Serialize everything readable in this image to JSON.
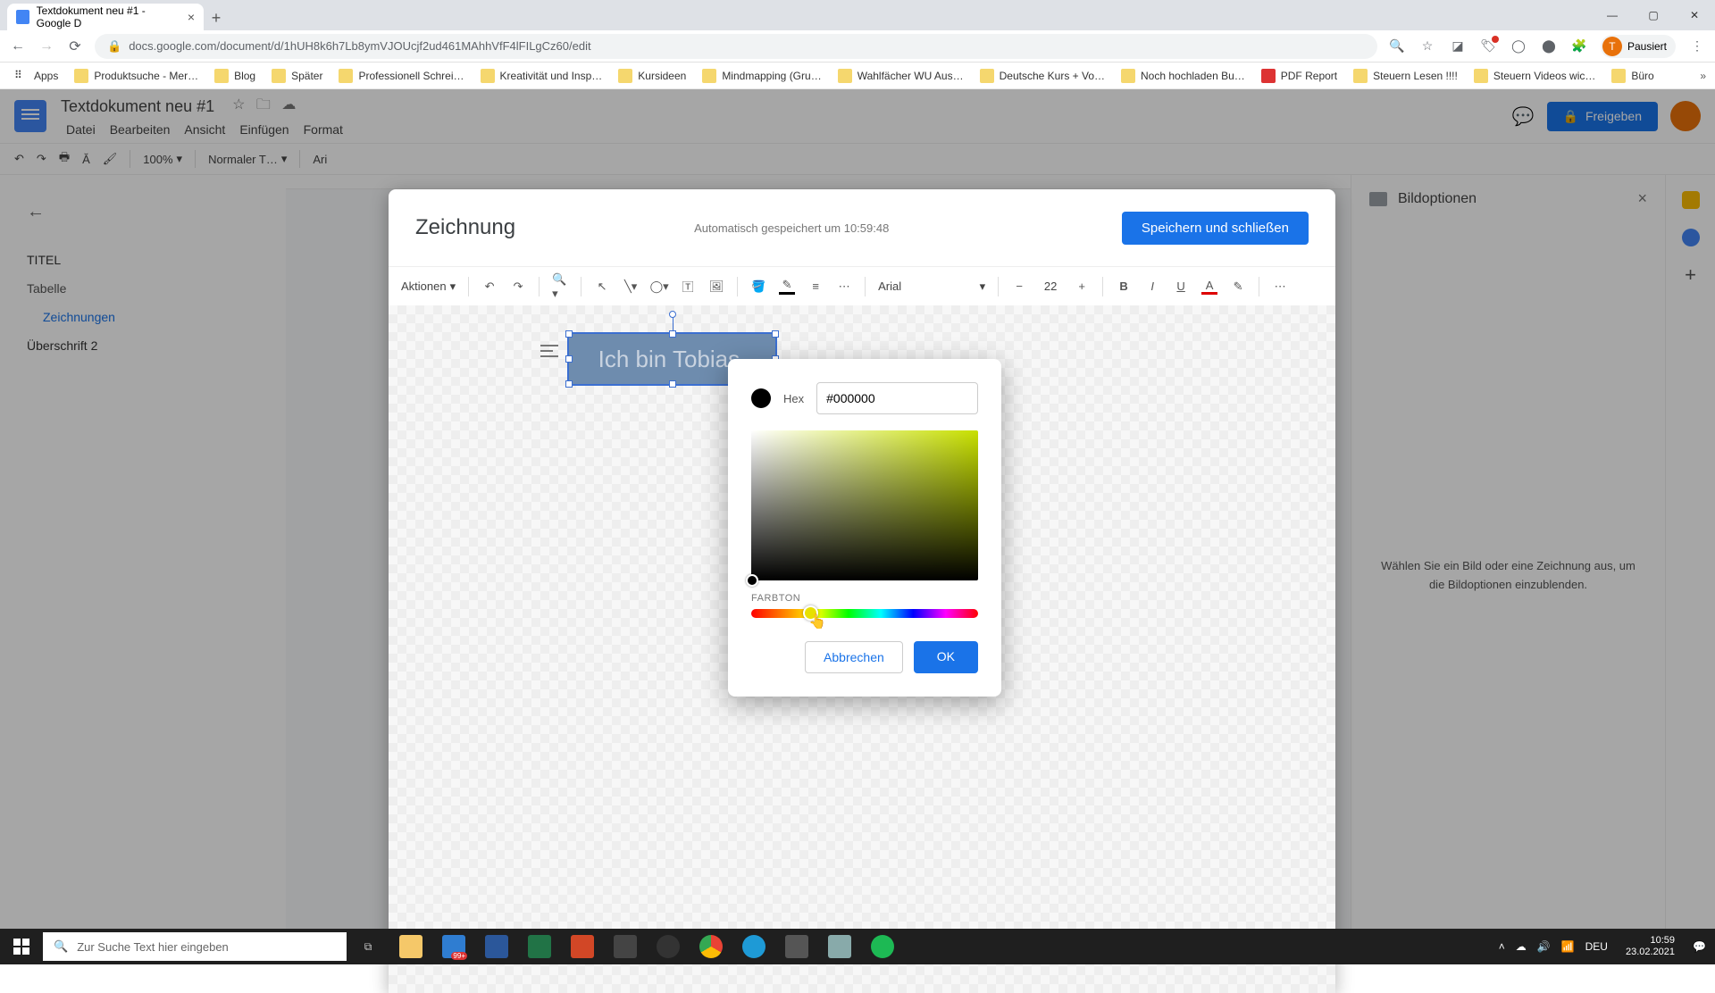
{
  "browser": {
    "tab_title": "Textdokument neu #1 - Google D",
    "new_tab": "+",
    "url": "docs.google.com/document/d/1hUH8k6h7Lb8ymVJOUcjf2ud461MAhhVfF4lFILgCz60/edit",
    "profile_label": "Pausiert",
    "profile_initial": "T"
  },
  "bookmarks": [
    "Apps",
    "Produktsuche - Mer…",
    "Blog",
    "Später",
    "Professionell Schrei…",
    "Kreativität und Insp…",
    "Kursideen",
    "Mindmapping  (Gru…",
    "Wahlfächer WU Aus…",
    "Deutsche Kurs + Vo…",
    "Noch hochladen Bu…",
    "PDF Report",
    "Steuern Lesen !!!!",
    "Steuern Videos wic…",
    "Büro"
  ],
  "docs": {
    "title": "Textdokument neu #1",
    "menus": [
      "Datei",
      "Bearbeiten",
      "Ansicht",
      "Einfügen",
      "Format"
    ],
    "share": "Freigeben",
    "zoom": "100%",
    "style": "Normaler T…",
    "font": "Ari"
  },
  "outline": {
    "items": [
      {
        "label": "TITEL",
        "cls": "bold"
      },
      {
        "label": "Tabelle",
        "cls": ""
      },
      {
        "label": "Zeichnungen",
        "cls": "sub"
      },
      {
        "label": "Überschrift 2",
        "cls": "bold"
      }
    ]
  },
  "right": {
    "title": "Bildoptionen",
    "body": "Wählen Sie ein Bild oder eine Zeichnung aus, um die Bildoptionen einzublenden."
  },
  "drawing": {
    "title": "Zeichnung",
    "autosave": "Automatisch gespeichert um 10:59:48",
    "save": "Speichern und schließen",
    "actions": "Aktionen",
    "font": "Arial",
    "font_size": "22",
    "textbox": "Ich bin Tobias."
  },
  "color": {
    "hex_label": "Hex",
    "hex_value": "#000000",
    "hue_label": "FARBTON",
    "cancel": "Abbrechen",
    "ok": "OK"
  },
  "taskbar": {
    "search_placeholder": "Zur Suche Text hier eingeben",
    "badge": "99+",
    "lang": "DEU",
    "time": "10:59",
    "date": "23.02.2021"
  }
}
